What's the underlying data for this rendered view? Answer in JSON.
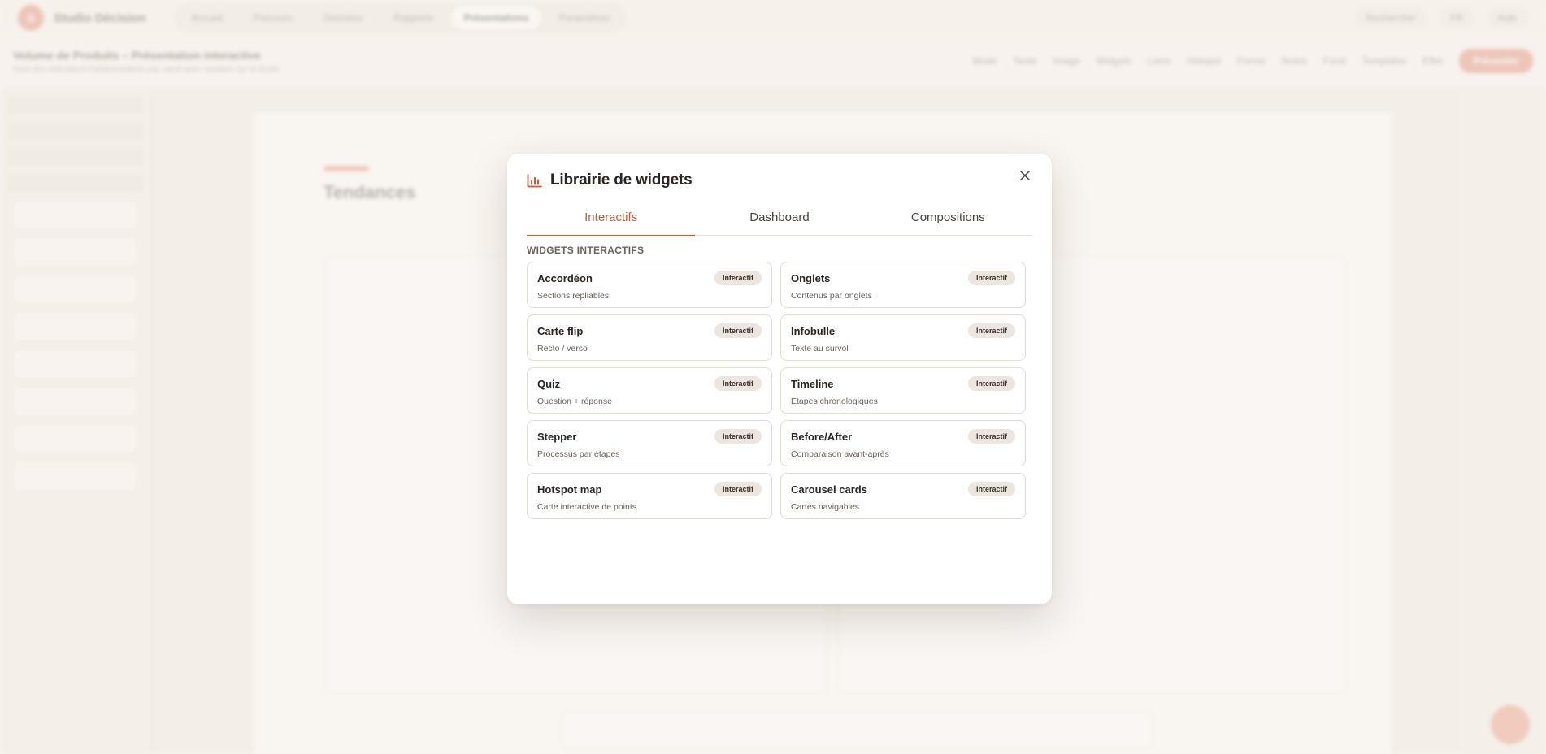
{
  "app": {
    "brand_initial": "S",
    "brand_name": "Studio Décision",
    "nav": [
      "Accueil",
      "Parcours",
      "Données",
      "Rapports",
      "Présentations",
      "Paramètres"
    ],
    "nav_active_index": 4,
    "top_right": [
      "Rechercher",
      "FR",
      "Aide"
    ],
    "document_title": "Volume de Produits – Présentation interactive",
    "document_subtitle": "Suivi des indicateurs hebdomadaires par canal avec variation sur la durée",
    "toolbar": [
      "Mode",
      "Texte",
      "Image",
      "Widgets",
      "Liens",
      "Hotspot",
      "Forme",
      "Notes",
      "Fond",
      "Templates",
      "Effet"
    ],
    "present_label": "Présenter",
    "slide_title": "Tendances"
  },
  "modal": {
    "title": "Librairie de widgets",
    "tabs": [
      {
        "label": "Interactifs",
        "active": true
      },
      {
        "label": "Dashboard",
        "active": false
      },
      {
        "label": "Compositions",
        "active": false
      }
    ],
    "section_label": "WIDGETS INTERACTIFS",
    "widgets": [
      {
        "name": "Accordéon",
        "description": "Sections repliables",
        "badge": "Interactif"
      },
      {
        "name": "Onglets",
        "description": "Contenus par onglets",
        "badge": "Interactif"
      },
      {
        "name": "Carte flip",
        "description": "Recto / verso",
        "badge": "Interactif"
      },
      {
        "name": "Infobulle",
        "description": "Texte au survol",
        "badge": "Interactif"
      },
      {
        "name": "Quiz",
        "description": "Question + réponse",
        "badge": "Interactif"
      },
      {
        "name": "Timeline",
        "description": "Étapes chronologiques",
        "badge": "Interactif"
      },
      {
        "name": "Stepper",
        "description": "Processus par étapes",
        "badge": "Interactif"
      },
      {
        "name": "Before/After",
        "description": "Comparaison avant-après",
        "badge": "Interactif"
      },
      {
        "name": "Hotspot map",
        "description": "Carte interactive de points",
        "badge": "Interactif"
      },
      {
        "name": "Carousel cards",
        "description": "Cartes navigables",
        "badge": "Interactif"
      }
    ]
  },
  "colors": {
    "accent": "#c75a3a",
    "brand": "#e07a5f",
    "badge_bg": "#ece6df",
    "card_border": "#e2dbd3"
  },
  "icons": {
    "modal_title": "bar-chart-icon",
    "close": "close-icon"
  }
}
